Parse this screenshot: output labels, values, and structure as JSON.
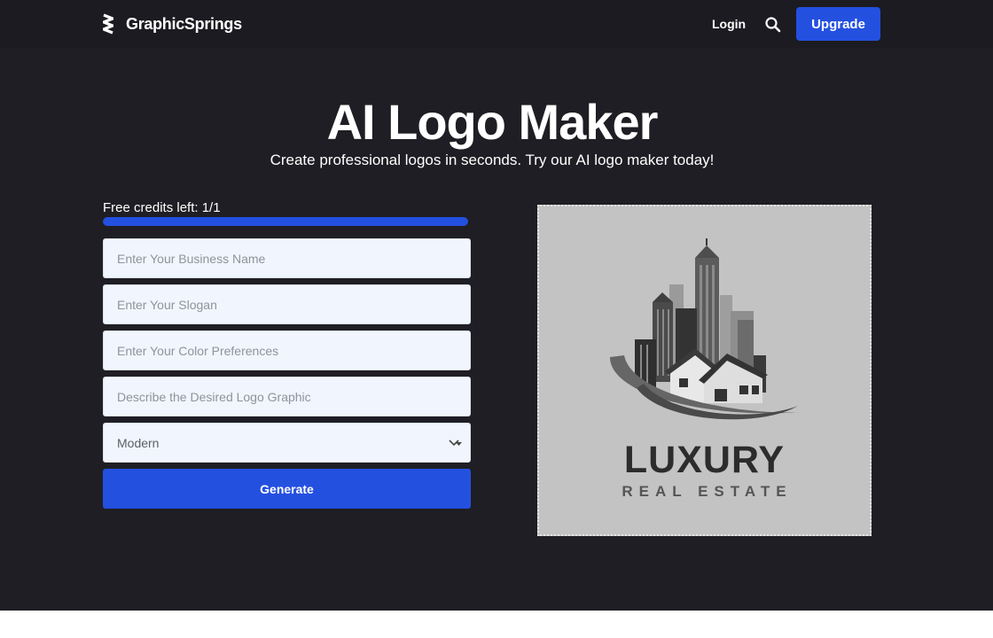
{
  "header": {
    "brand": "GraphicSprings",
    "login_label": "Login",
    "search_icon": "search-icon",
    "upgrade_label": "Upgrade"
  },
  "hero": {
    "title": "AI Logo Maker",
    "subtitle": "Create professional logos in seconds. Try our AI logo maker today!"
  },
  "form": {
    "credits_text": "Free credits left: 1/1",
    "credits_progress": 1.0,
    "business_name": {
      "value": "",
      "placeholder": "Enter Your Business Name"
    },
    "slogan": {
      "value": "",
      "placeholder": "Enter Your Slogan"
    },
    "colors": {
      "value": "",
      "placeholder": "Enter Your Color Preferences"
    },
    "graphic": {
      "value": "",
      "placeholder": "Describe the Desired Logo Graphic"
    },
    "style_select": {
      "selected": "Modern"
    },
    "generate_label": "Generate"
  },
  "preview": {
    "brand_name": "LUXURY",
    "tagline": "REAL ESTATE"
  },
  "colors": {
    "background": "#1f1e24",
    "accent": "#2450e0",
    "input_bg": "#f1f5fd",
    "preview_bg": "#c3c3c3"
  }
}
